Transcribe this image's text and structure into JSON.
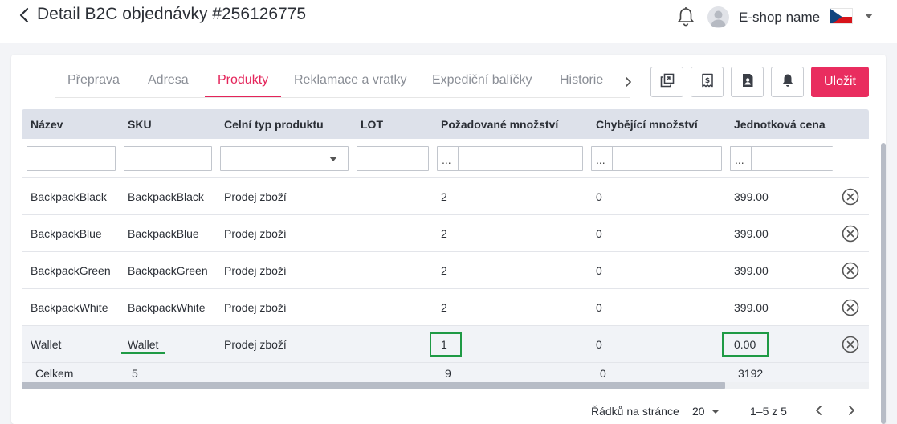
{
  "header": {
    "title": "Detail B2C objednávky #256126775",
    "shop_name": "E-shop name"
  },
  "tabs": [
    {
      "label": "Přeprava"
    },
    {
      "label": "Adresa"
    },
    {
      "label": "Produkty",
      "active": true
    },
    {
      "label": "Reklamace a vratky"
    },
    {
      "label": "Expediční balíčky"
    },
    {
      "label": "Historie"
    }
  ],
  "toolbar": {
    "icons": [
      "copy-icon",
      "invoice-dollar-icon",
      "contact-card-icon",
      "bell-icon"
    ],
    "save_label": "Uložit"
  },
  "table": {
    "columns": [
      "Název",
      "SKU",
      "Celní typ produktu",
      "LOT",
      "Požadované množství",
      "Chybějící množství",
      "Jednotková cena"
    ],
    "filter_ellipsis": "...",
    "rows": [
      {
        "name": "BackpackBlack",
        "sku": "BackpackBlack",
        "customs_type": "Prodej zboží",
        "lot": "",
        "requested": "2",
        "missing": "0",
        "unit_price": "399.00"
      },
      {
        "name": "BackpackBlue",
        "sku": "BackpackBlue",
        "customs_type": "Prodej zboží",
        "lot": "",
        "requested": "2",
        "missing": "0",
        "unit_price": "399.00"
      },
      {
        "name": "BackpackGreen",
        "sku": "BackpackGreen",
        "customs_type": "Prodej zboží",
        "lot": "",
        "requested": "2",
        "missing": "0",
        "unit_price": "399.00"
      },
      {
        "name": "BackpackWhite",
        "sku": "BackpackWhite",
        "customs_type": "Prodej zboží",
        "lot": "",
        "requested": "2",
        "missing": "0",
        "unit_price": "399.00"
      },
      {
        "name": "Wallet",
        "sku": "Wallet",
        "customs_type": "Prodej zboží",
        "lot": "",
        "requested": "1",
        "missing": "0",
        "unit_price": "0.00"
      }
    ],
    "totals": {
      "label": "Celkem",
      "count": "5",
      "requested": "9",
      "missing": "0",
      "unit_price": "3192"
    }
  },
  "pagination": {
    "rows_per_page_label": "Řádků na stránce",
    "rows_per_page": "20",
    "range": "1–5 z 5"
  },
  "colors": {
    "accent": "#e4245a",
    "save_button": "#e92d5f",
    "highlight": "#1f9a45",
    "header_bg": "#dde1ea"
  }
}
